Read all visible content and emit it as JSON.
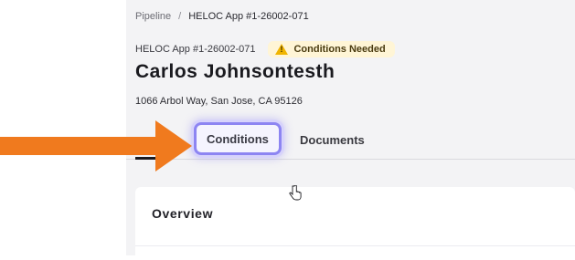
{
  "breadcrumb": {
    "root": "Pipeline",
    "separator": "/",
    "current": "HELOC App #1-26002-071"
  },
  "application": {
    "id_label": "HELOC App #1-26002-071",
    "status_badge": "Conditions Needed",
    "status_color": "#fff5d6",
    "status_icon": "warning-triangle-icon"
  },
  "applicant": {
    "name": "Carlos Johnsontesth",
    "address": "1066 Arbol Way, San Jose, CA 95126"
  },
  "tabs": [
    {
      "label": "Conditions",
      "highlighted": true
    },
    {
      "label": "Documents"
    }
  ],
  "overview": {
    "title": "Overview"
  },
  "colors": {
    "annotation_arrow": "#f07a1e",
    "highlight_ring": "#8d85f2",
    "content_bg": "#f3f3f5"
  }
}
